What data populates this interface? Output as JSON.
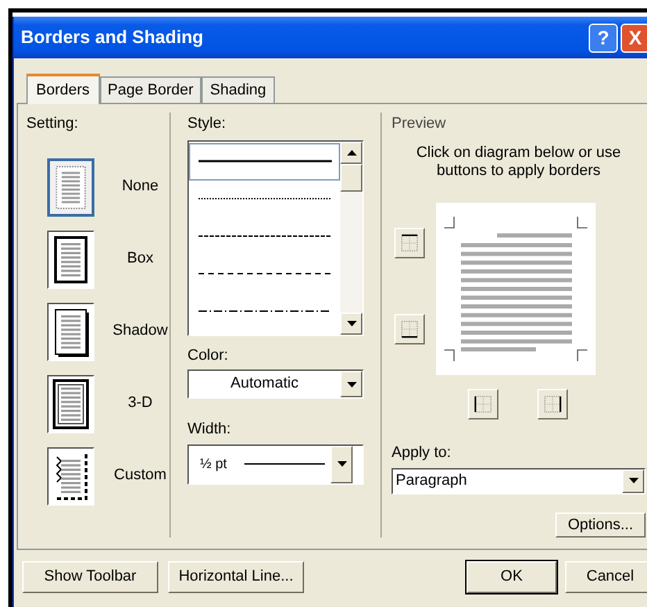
{
  "window": {
    "title": "Borders and Shading",
    "help": "?",
    "close": "X"
  },
  "tabs": [
    {
      "label": "Borders",
      "selected": true
    },
    {
      "label": "Page Border",
      "selected": false
    },
    {
      "label": "Shading",
      "selected": false
    }
  ],
  "setting": {
    "label": "Setting:",
    "items": [
      {
        "label": "None",
        "kind": "none",
        "selected": true
      },
      {
        "label": "Box",
        "kind": "box",
        "selected": false
      },
      {
        "label": "Shadow",
        "kind": "shadow",
        "selected": false
      },
      {
        "label": "3-D",
        "kind": "double",
        "selected": false
      },
      {
        "label": "Custom",
        "kind": "custom",
        "selected": false
      }
    ]
  },
  "style": {
    "label": "Style:",
    "items": [
      {
        "kind": "solid",
        "selected": true
      },
      {
        "kind": "dotted",
        "selected": false
      },
      {
        "kind": "fine-dash",
        "selected": false
      },
      {
        "kind": "dash",
        "selected": false
      },
      {
        "kind": "dash-dot",
        "selected": false
      }
    ]
  },
  "color": {
    "label": "Color:",
    "value": "Automatic"
  },
  "width": {
    "label": "Width:",
    "value": "½ pt"
  },
  "preview": {
    "label": "Preview",
    "hint": "Click on diagram below or use buttons to apply borders"
  },
  "apply_to": {
    "label": "Apply to:",
    "value": "Paragraph"
  },
  "options_button": "Options...",
  "footer": {
    "left": [
      "Show Toolbar",
      "Horizontal Line..."
    ],
    "right": [
      "OK",
      "Cancel"
    ]
  }
}
